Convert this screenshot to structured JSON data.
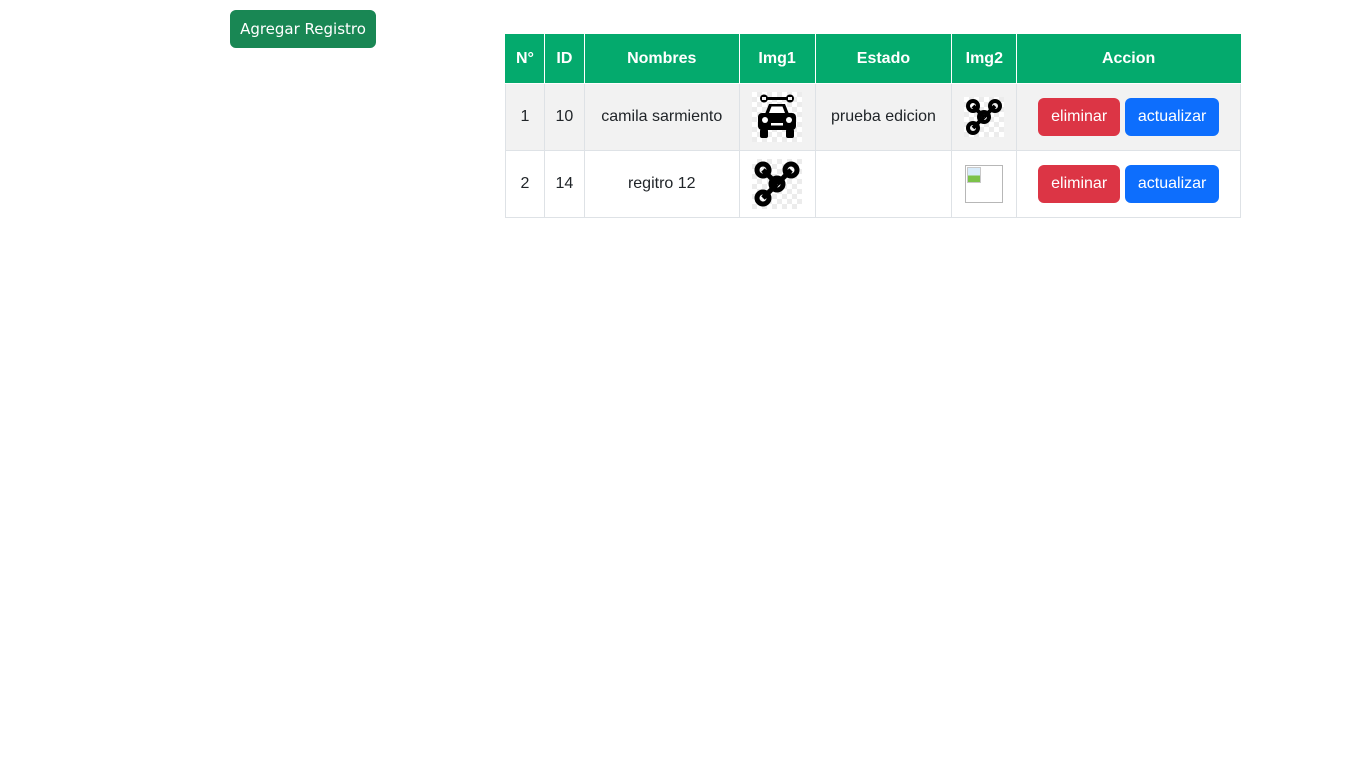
{
  "toolbar": {
    "add_label": "Agregar Registro",
    "add_color": "#198754"
  },
  "table": {
    "header_color": "#04aa6d",
    "headers": [
      "N°",
      "ID",
      "Nombres",
      "Img1",
      "Estado",
      "Img2",
      "Accion"
    ],
    "rows": [
      {
        "num": "1",
        "id": "10",
        "nombres": "camila sarmiento",
        "img1": "car-repair-icon",
        "estado": "prueba edicion",
        "img2": "hub-icon",
        "delete_label": "eliminar",
        "update_label": "actualizar"
      },
      {
        "num": "2",
        "id": "14",
        "nombres": "regitro 12",
        "img1": "hub-icon",
        "estado": "",
        "img2": "broken-image-icon",
        "delete_label": "eliminar",
        "update_label": "actualizar"
      }
    ]
  },
  "colors": {
    "danger": "#dc3545",
    "primary": "#0d6efd",
    "row_stripe": "#f2f2f2"
  }
}
